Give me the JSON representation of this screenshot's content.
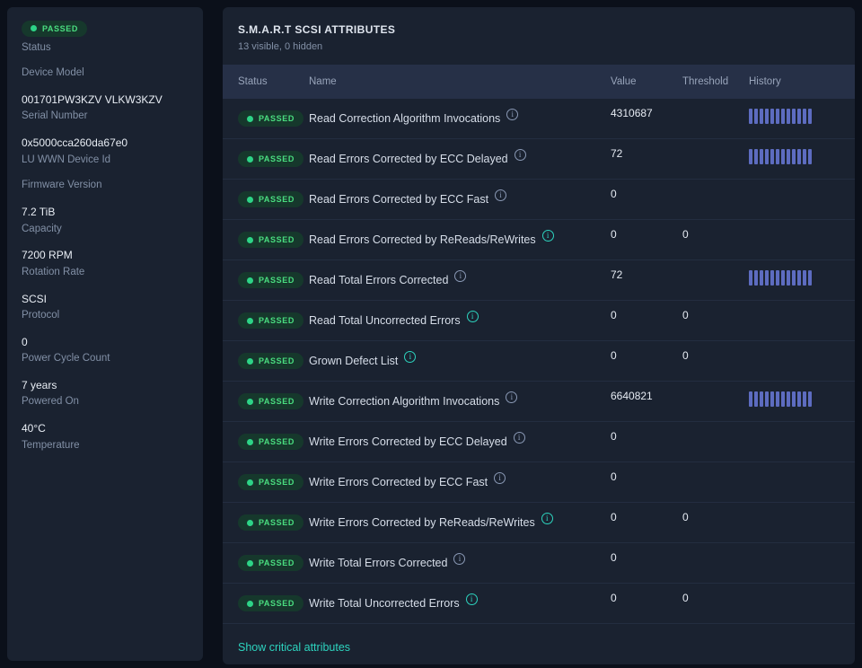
{
  "colors": {
    "passed_green": "#4ade80",
    "history_bar_indigo": "#5d6cc0",
    "link_teal": "#2dd4bf"
  },
  "sidebar": {
    "items": [
      {
        "type": "badge",
        "value": "PASSED",
        "label": "Status"
      },
      {
        "type": "text",
        "value": "",
        "label": "Device Model"
      },
      {
        "type": "text",
        "value": "001701PW3KZV VLKW3KZV",
        "label": "Serial Number"
      },
      {
        "type": "text",
        "value": "0x5000cca260da67e0",
        "label": "LU WWN Device Id"
      },
      {
        "type": "text",
        "value": "",
        "label": "Firmware Version"
      },
      {
        "type": "text",
        "value": "7.2 TiB",
        "label": "Capacity"
      },
      {
        "type": "text",
        "value": "7200 RPM",
        "label": "Rotation Rate"
      },
      {
        "type": "text",
        "value": "SCSI",
        "label": "Protocol"
      },
      {
        "type": "text",
        "value": "0",
        "label": "Power Cycle Count"
      },
      {
        "type": "text",
        "value": "7 years",
        "label": "Powered On"
      },
      {
        "type": "text",
        "value": "40°C",
        "label": "Temperature"
      }
    ]
  },
  "main": {
    "title": "S.M.A.R.T SCSI ATTRIBUTES",
    "subtitle": "13 visible, 0 hidden",
    "footer_link": "Show critical attributes",
    "table": {
      "headers": [
        "Status",
        "Name",
        "Value",
        "Threshold",
        "History"
      ],
      "history_bar_count": 12,
      "rows": [
        {
          "status": "PASSED",
          "name": "Read Correction Algorithm Invocations",
          "value": "4310687",
          "threshold": "",
          "history": true,
          "critical": false
        },
        {
          "status": "PASSED",
          "name": "Read Errors Corrected by ECC Delayed",
          "value": "72",
          "threshold": "",
          "history": true,
          "critical": false
        },
        {
          "status": "PASSED",
          "name": "Read Errors Corrected by ECC Fast",
          "value": "0",
          "threshold": "",
          "history": false,
          "critical": false
        },
        {
          "status": "PASSED",
          "name": "Read Errors Corrected by ReReads/ReWrites",
          "value": "0",
          "threshold": "0",
          "history": false,
          "critical": true
        },
        {
          "status": "PASSED",
          "name": "Read Total Errors Corrected",
          "value": "72",
          "threshold": "",
          "history": true,
          "critical": false
        },
        {
          "status": "PASSED",
          "name": "Read Total Uncorrected Errors",
          "value": "0",
          "threshold": "0",
          "history": false,
          "critical": true
        },
        {
          "status": "PASSED",
          "name": "Grown Defect List",
          "value": "0",
          "threshold": "0",
          "history": false,
          "critical": true
        },
        {
          "status": "PASSED",
          "name": "Write Correction Algorithm Invocations",
          "value": "6640821",
          "threshold": "",
          "history": true,
          "critical": false
        },
        {
          "status": "PASSED",
          "name": "Write Errors Corrected by ECC Delayed",
          "value": "0",
          "threshold": "",
          "history": false,
          "critical": false
        },
        {
          "status": "PASSED",
          "name": "Write Errors Corrected by ECC Fast",
          "value": "0",
          "threshold": "",
          "history": false,
          "critical": false
        },
        {
          "status": "PASSED",
          "name": "Write Errors Corrected by ReReads/ReWrites",
          "value": "0",
          "threshold": "0",
          "history": false,
          "critical": true
        },
        {
          "status": "PASSED",
          "name": "Write Total Errors Corrected",
          "value": "0",
          "threshold": "",
          "history": false,
          "critical": false
        },
        {
          "status": "PASSED",
          "name": "Write Total Uncorrected Errors",
          "value": "0",
          "threshold": "0",
          "history": false,
          "critical": true
        }
      ]
    }
  }
}
